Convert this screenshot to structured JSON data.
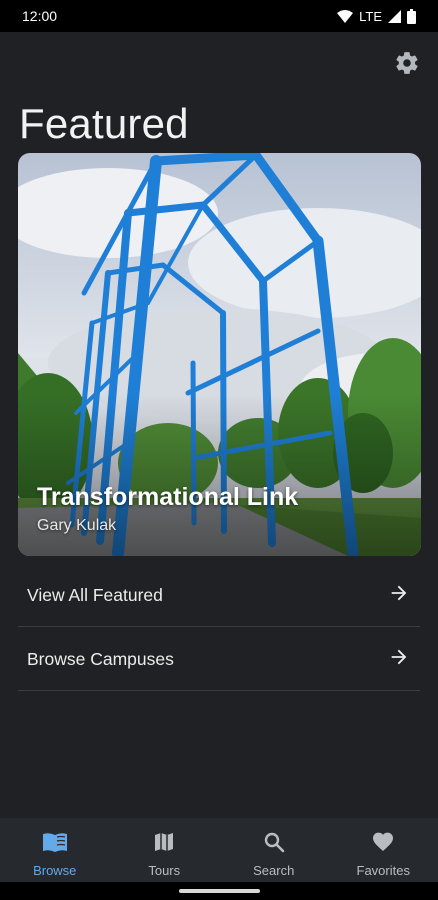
{
  "status_bar": {
    "time": "12:00",
    "network": "LTE"
  },
  "header": {
    "title": "Featured",
    "settings_icon": "gear-icon"
  },
  "featured": {
    "title": "Transformational Link",
    "artist": "Gary Kulak"
  },
  "menu": [
    {
      "label": "View All Featured",
      "icon": "arrow-right-icon"
    },
    {
      "label": "Browse Campuses",
      "icon": "arrow-right-icon"
    }
  ],
  "bottom_nav": [
    {
      "label": "Browse",
      "icon": "book-icon",
      "active": true
    },
    {
      "label": "Tours",
      "icon": "map-icon",
      "active": false
    },
    {
      "label": "Search",
      "icon": "search-icon",
      "active": false
    },
    {
      "label": "Favorites",
      "icon": "heart-icon",
      "active": false
    }
  ],
  "colors": {
    "background": "#1f2124",
    "nav_background": "#262a2f",
    "accent": "#64a9e8",
    "sculpture_blue": "#1f7fd6"
  }
}
